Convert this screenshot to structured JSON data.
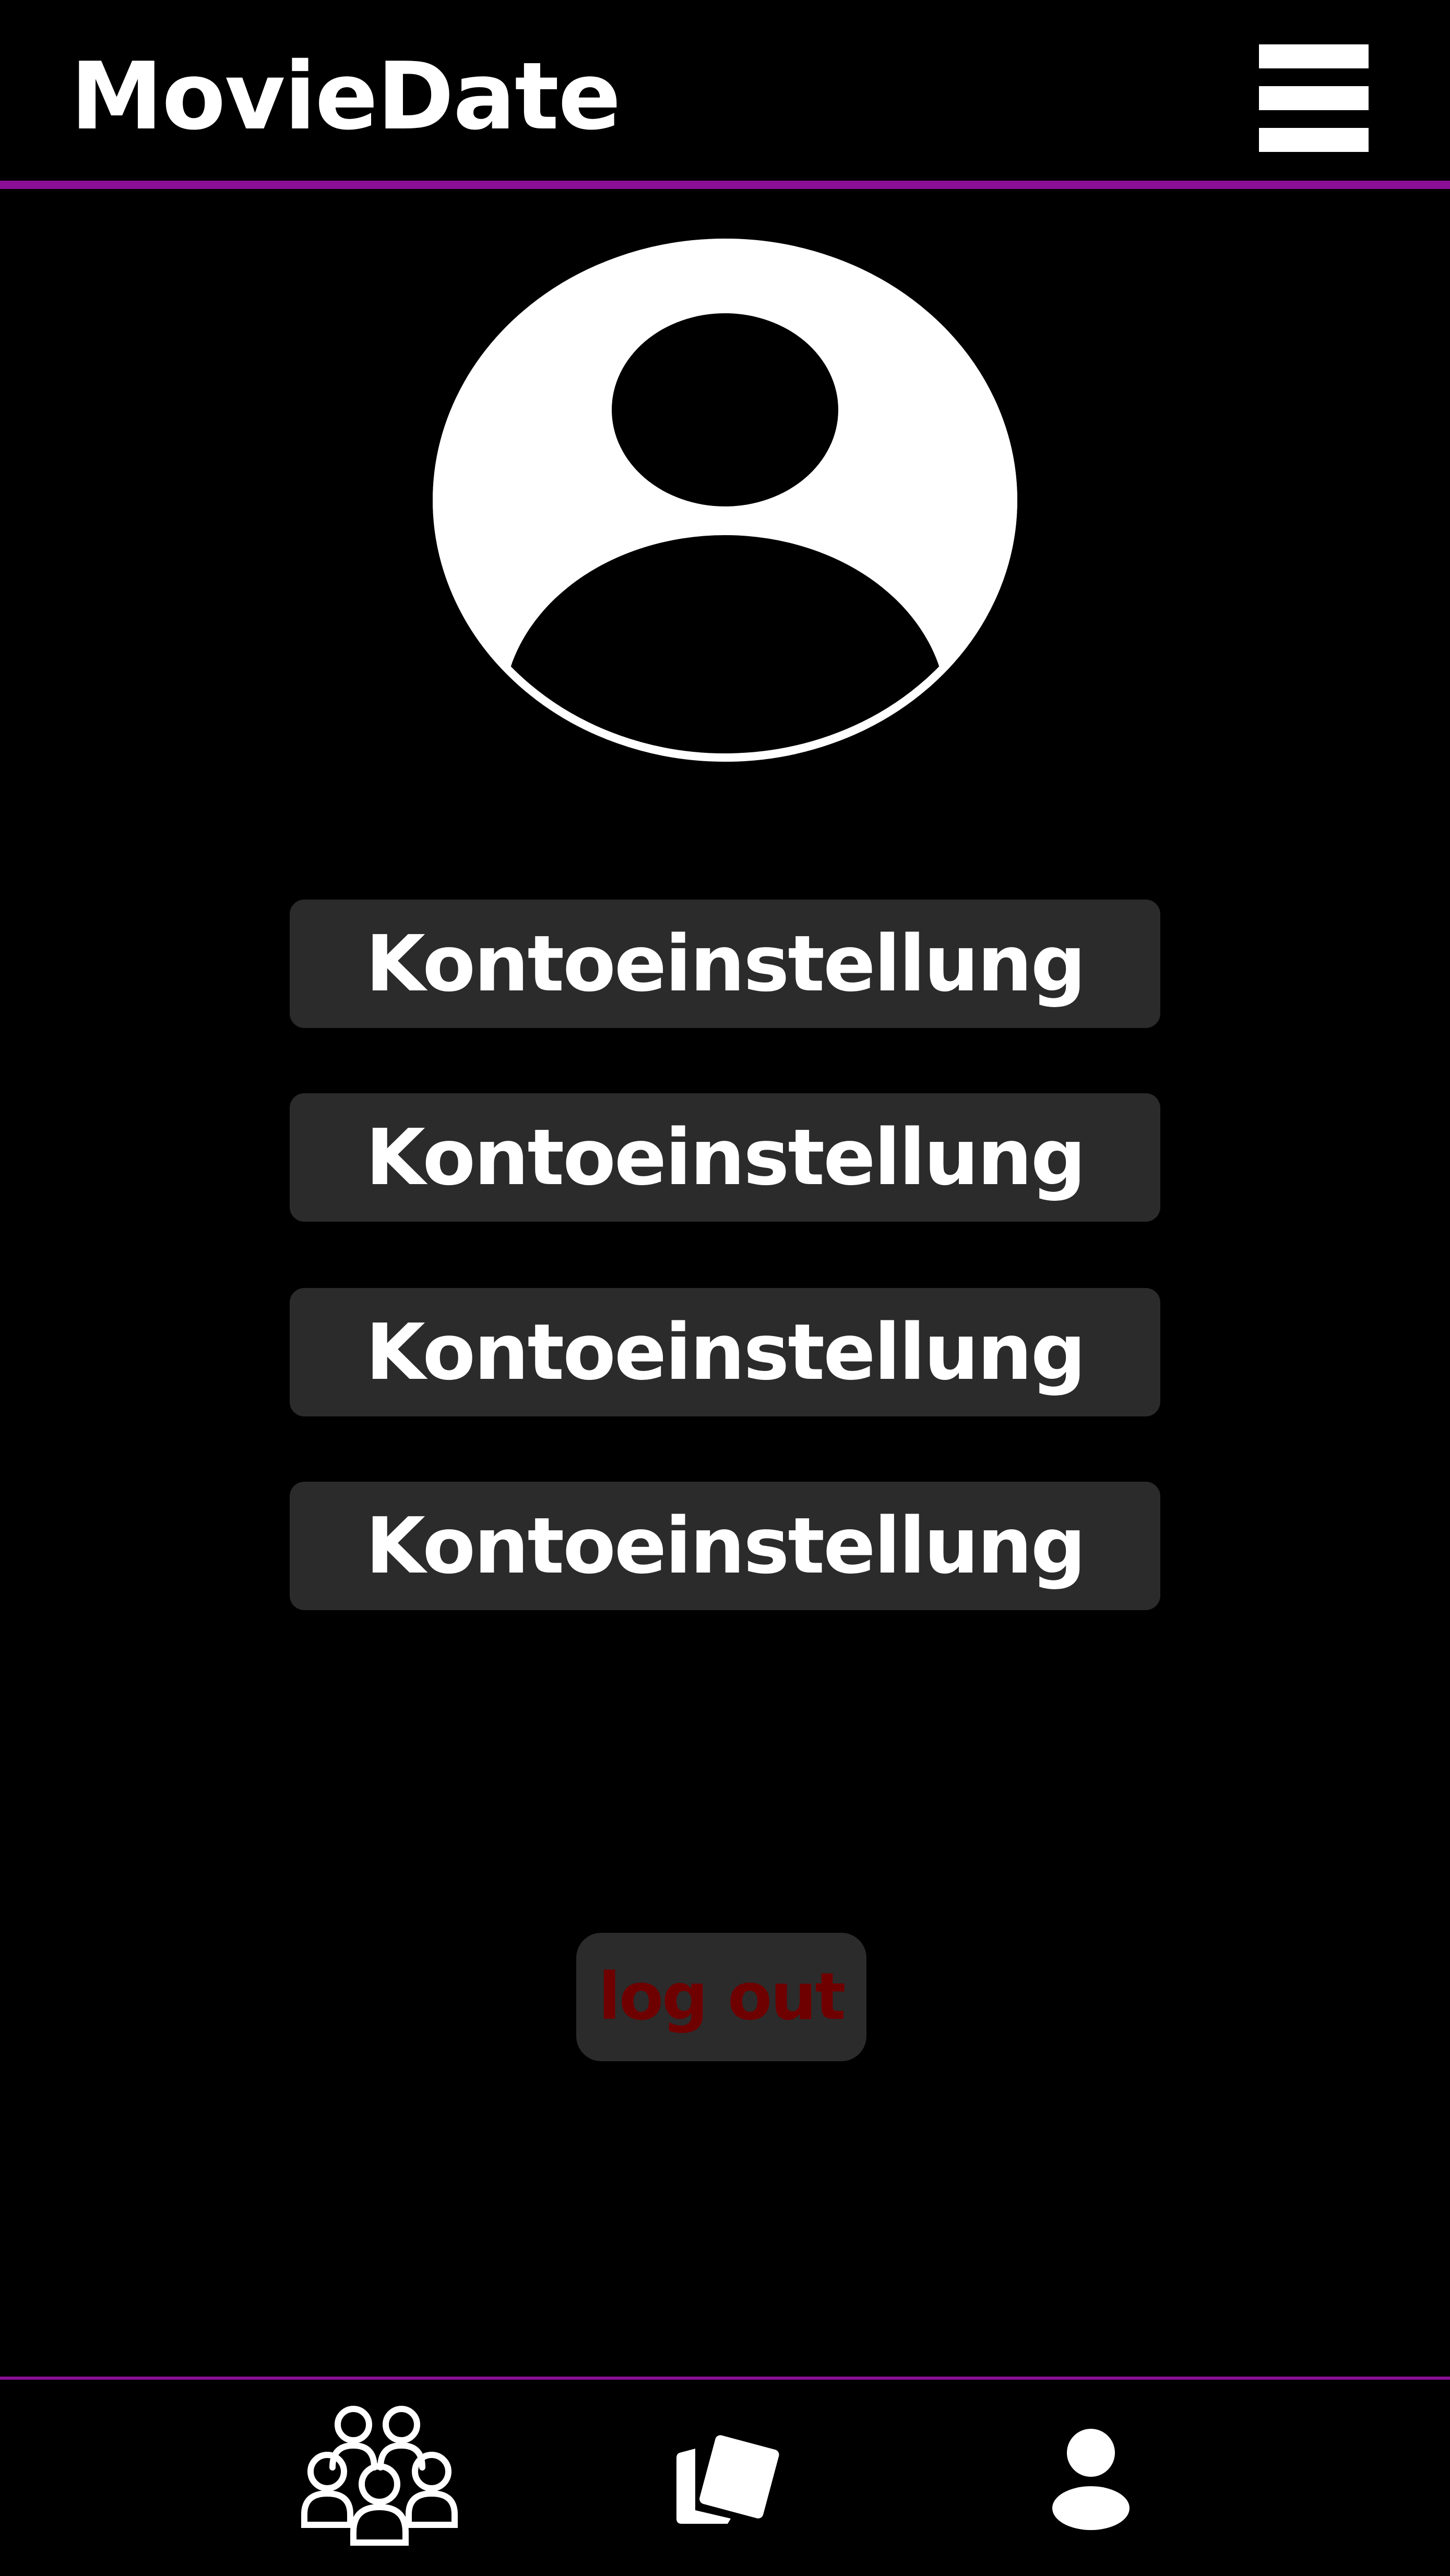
{
  "header": {
    "app_title": "MovieDate",
    "menu_icon": "hamburger-menu-icon"
  },
  "profile": {
    "avatar_icon": "user-avatar-icon"
  },
  "settings": {
    "items": [
      {
        "label": "Kontoeinstellung"
      },
      {
        "label": "Kontoeinstellung"
      },
      {
        "label": "Kontoeinstellung"
      },
      {
        "label": "Kontoeinstellung"
      }
    ]
  },
  "logout": {
    "label": "log out"
  },
  "bottom_nav": {
    "items": [
      {
        "icon": "group-icon"
      },
      {
        "icon": "cards-icon"
      },
      {
        "icon": "profile-icon"
      }
    ]
  },
  "colors": {
    "background": "#000000",
    "accent": "#8a0f96",
    "button_bg": "#2b2b2b",
    "logout_text": "#6f0000",
    "text": "#ffffff"
  }
}
